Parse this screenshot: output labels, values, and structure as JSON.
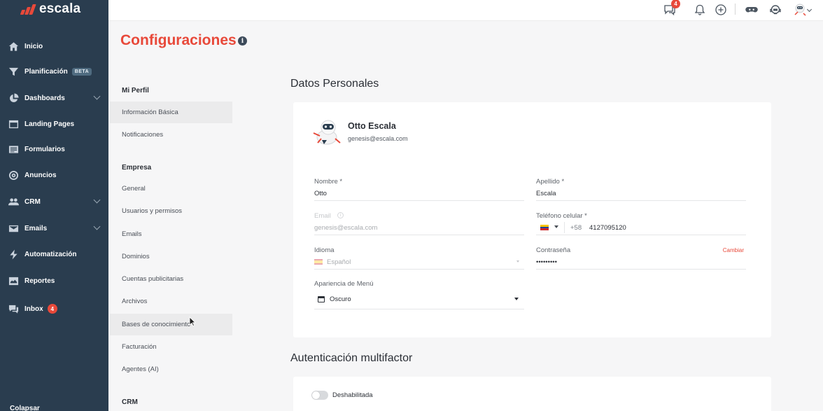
{
  "brand": {
    "name": "escala",
    "accent": "#e8493a",
    "sidebar_bg": "#2a3d4f"
  },
  "sidebar": {
    "items": [
      {
        "label": "Inicio",
        "icon": "home-icon"
      },
      {
        "label": "Planificación",
        "icon": "filter-icon",
        "tag": "BETA"
      },
      {
        "label": "Dashboards",
        "icon": "pie-chart-icon",
        "has_children": true
      },
      {
        "label": "Landing Pages",
        "icon": "browser-icon"
      },
      {
        "label": "Formularios",
        "icon": "form-icon"
      },
      {
        "label": "Anuncios",
        "icon": "target-icon"
      },
      {
        "label": "CRM",
        "icon": "users-icon",
        "has_children": true
      },
      {
        "label": "Emails",
        "icon": "mail-icon",
        "has_children": true
      },
      {
        "label": "Automatización",
        "icon": "lightning-icon"
      },
      {
        "label": "Reportes",
        "icon": "report-icon"
      },
      {
        "label": "Inbox",
        "icon": "chat-icon",
        "badge": "4"
      }
    ],
    "collapse_label": "Colapsar"
  },
  "topbar": {
    "messages_badge": "4"
  },
  "page": {
    "title": "Configuraciones"
  },
  "submenu": {
    "groups": [
      {
        "heading": "Mi Perfil",
        "items": [
          "Información Básica",
          "Notificaciones"
        ]
      },
      {
        "heading": "Empresa",
        "items": [
          "General",
          "Usuarios y permisos",
          "Emails",
          "Dominios",
          "Cuentas publicitarias",
          "Archivos",
          "Bases de conocimiento",
          "Facturación",
          "Agentes (AI)"
        ]
      },
      {
        "heading": "CRM",
        "items": []
      }
    ],
    "active_item": "Información Básica"
  },
  "personal": {
    "section_title": "Datos Personales",
    "user_name": "Otto Escala",
    "user_email": "genesis@escala.com",
    "fields": {
      "nombre": {
        "label": "Nombre *",
        "value": "Otto"
      },
      "apellido": {
        "label": "Apellido *",
        "value": "Escala"
      },
      "email": {
        "label": "Email",
        "value": "genesis@escala.com"
      },
      "telefono": {
        "label": "Teléfono celular *",
        "code": "+58",
        "value": "4127095120"
      },
      "idioma": {
        "label": "Idioma",
        "value": "Español"
      },
      "contrasena": {
        "label": "Contraseña",
        "value": "•••••••••",
        "action": "Cambiar"
      },
      "apariencia": {
        "label": "Apariencia de Menú",
        "value": "Oscuro"
      }
    }
  },
  "mfa": {
    "section_title": "Autenticación multifactor",
    "status": "Deshabilitada"
  }
}
